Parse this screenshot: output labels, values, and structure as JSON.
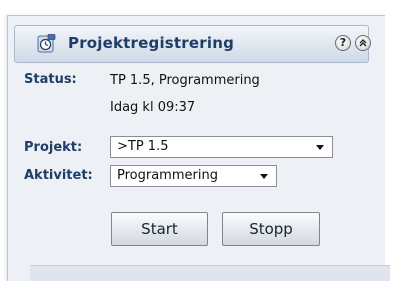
{
  "header": {
    "title": "Projektregistrering",
    "help_label": "?",
    "collapse_label": "«"
  },
  "status": {
    "label": "Status:",
    "line1": "TP 1.5, Programmering",
    "line2": "Idag kl 09:37"
  },
  "projekt": {
    "label": "Projekt:",
    "selected": ">TP 1.5"
  },
  "aktivitet": {
    "label": "Aktivitet:",
    "selected": "Programmering"
  },
  "buttons": {
    "start": "Start",
    "stop": "Stopp"
  },
  "colors": {
    "title": "#1f3d66",
    "panel_bg": "#edf1f6"
  }
}
